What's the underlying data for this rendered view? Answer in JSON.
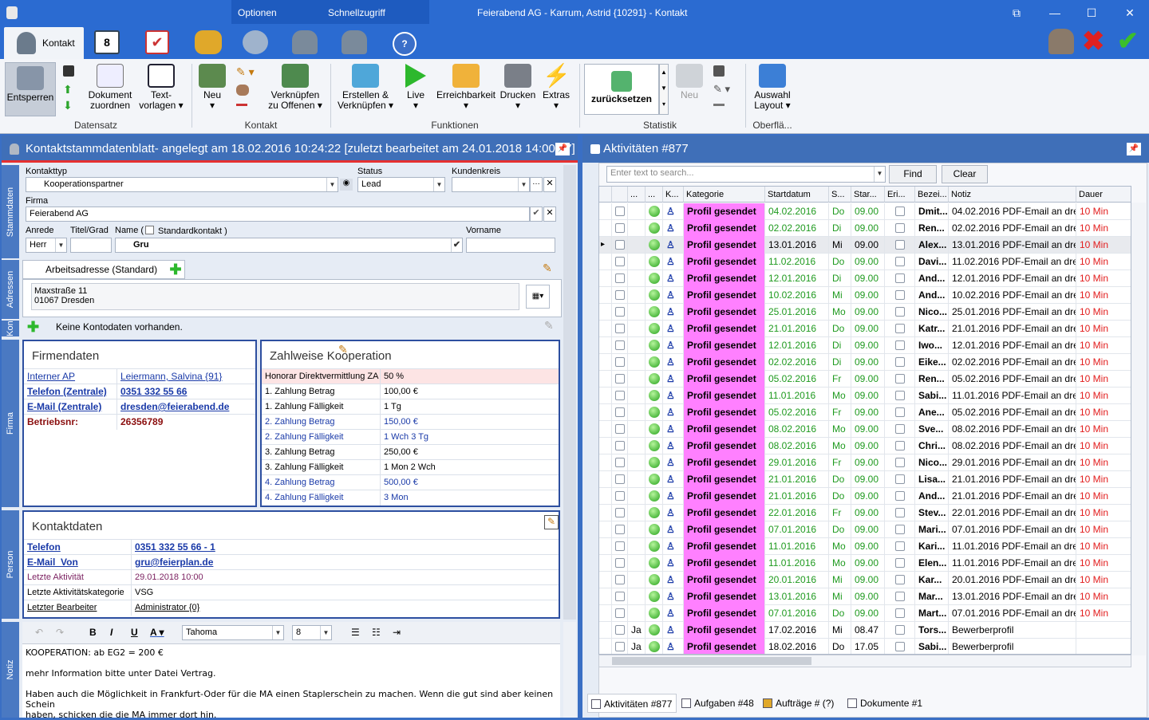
{
  "window": {
    "title": "Feierabend AG - Karrum, Astrid {10291} - Kontakt",
    "ctx_tab1": "Optionen",
    "ctx_tab2": "Schnellzugriff"
  },
  "ribbon": {
    "active_tab": "Kontakt",
    "buttons": {
      "entsperren": "Entsperren",
      "dokument": "Dokument",
      "zuordnen": "zuordnen",
      "text": "Text-",
      "vorlagen": "vorlagen ▾",
      "neu": "Neu",
      "verknuepfen": "Verknüpfen",
      "zu_offenen": "zu Offenen ▾",
      "erstellen": "Erstellen &",
      "verknuepfen2": "Verknüpfen ▾",
      "live": "Live",
      "erreichbarkeit": "Erreichbarkeit",
      "drucken": "Drucken",
      "extras": "Extras",
      "zuruecksetzen": "zurücksetzen",
      "neu2": "Neu",
      "auswahl": "Auswahl",
      "layout": "Layout ▾"
    },
    "groups": [
      "Datensatz",
      "Kontakt",
      "Funktionen",
      "Statistik",
      "Oberflä..."
    ]
  },
  "left": {
    "header": "Kontaktstammdatenblatt- angelegt am 18.02.2016 10:24:22 [zuletzt bearbeitet am 24.01.2018 14:00:37]",
    "vtabs": [
      "Stammdaten",
      "Adressen",
      "Kon",
      "Firma",
      "Person",
      "Notiz"
    ],
    "labels": {
      "kontakttyp": "Kontakttyp",
      "status": "Status",
      "kundenkreis": "Kundenkreis",
      "firma": "Firma",
      "anrede": "Anrede",
      "titel": "Titel/Grad",
      "name": "Name (",
      "standard": "Standardkontakt )",
      "vorname": "Vorname"
    },
    "values": {
      "kontakttyp": "Kooperationspartner",
      "status": "Lead",
      "kundenkreis": "",
      "firma": "Feierabend AG",
      "anrede": "Herr",
      "titel": "",
      "name": "Gru",
      "vorname": ""
    },
    "address_tab": "Arbeitsadresse (Standard)",
    "address": {
      "street": "Maxstraße 11",
      "city": "01067 Dresden"
    },
    "konto": "Keine Kontodaten vorhanden.",
    "firmendaten": {
      "title": "Firmendaten",
      "rows": [
        [
          "Interner AP",
          "Leiermann, Salvina {91}"
        ],
        [
          "Telefon (Zentrale)",
          "0351 332 55 66"
        ],
        [
          "E-Mail (Zentrale)",
          "dresden@feierabend.de"
        ],
        [
          "Betriebsnr:",
          "26356789"
        ]
      ]
    },
    "zahlweise": {
      "title": "Zahlweise Kooperation",
      "rows": [
        [
          "Honorar Direktvermittlung ZA",
          "50 %"
        ],
        [
          "1. Zahlung Betrag",
          "100,00 €"
        ],
        [
          "1. Zahlung Fälligkeit",
          "1 Tg"
        ],
        [
          "2. Zahlung Betrag",
          "150,00 €"
        ],
        [
          "2. Zahlung Fälligkeit",
          "1 Wch 3 Tg"
        ],
        [
          "3. Zahlung Betrag",
          "250,00 €"
        ],
        [
          "3. Zahlung Fälligkeit",
          "1 Mon 2 Wch"
        ],
        [
          "4. Zahlung Betrag",
          "500,00 €"
        ],
        [
          "4. Zahlung Fälligkeit",
          "3 Mon"
        ]
      ]
    },
    "kontaktdaten": {
      "title": "Kontaktdaten",
      "rows": [
        [
          "Telefon",
          "0351 332 55 66 - 1"
        ],
        [
          "E-Mail_Von",
          "gru@feierplan.de"
        ],
        [
          "Letzte Aktivität",
          "29.01.2018 10:00"
        ],
        [
          "Letzte Aktivitätskategorie",
          "VSG"
        ],
        [
          "Letzter Bearbeiter",
          "Administrator {0}"
        ]
      ]
    },
    "editor": {
      "font": "Tahoma",
      "size": "8",
      "lines": [
        "KOOPERATION: ab EG2 = 200 €",
        "mehr Information bitte unter Datei Vertrag.",
        "Haben auch die Möglichkeit in Frankfurt-Oder für die MA einen Staplerschein zu machen. Wenn die gut sind aber keinen Schein",
        "haben, schicken die die MA immer dort hin."
      ]
    }
  },
  "right": {
    "header": "Aktivitäten #877",
    "search_placeholder": "Enter text to search...",
    "find": "Find",
    "clear": "Clear",
    "columns": [
      "...",
      "...",
      "K...",
      "Kategorie",
      "Startdatum",
      "S...",
      "Star...",
      "Eri...",
      "Bezei...",
      "Notiz",
      "Dauer"
    ],
    "rows": [
      [
        "",
        "Profil gesendet",
        "04.02.2016",
        "Do",
        "09.00",
        "Dmit...",
        "04.02.2016 PDF-Email an dre...",
        "10 Min",
        "g"
      ],
      [
        "",
        "Profil gesendet",
        "02.02.2016",
        "Di",
        "09.00",
        "Ren...",
        "02.02.2016 PDF-Email an dre...",
        "10 Min",
        "g"
      ],
      [
        "",
        "Profil gesendet",
        "13.01.2016",
        "Mi",
        "09.00",
        "Alex...",
        "13.01.2016 PDF-Email an dre...",
        "10 Min",
        "s"
      ],
      [
        "",
        "Profil gesendet",
        "11.02.2016",
        "Do",
        "09.00",
        "Davi...",
        "11.02.2016 PDF-Email an dre...",
        "10 Min",
        "g"
      ],
      [
        "",
        "Profil gesendet",
        "12.01.2016",
        "Di",
        "09.00",
        "And...",
        "12.01.2016 PDF-Email an dre...",
        "10 Min",
        "g"
      ],
      [
        "",
        "Profil gesendet",
        "10.02.2016",
        "Mi",
        "09.00",
        "And...",
        "10.02.2016 PDF-Email an dre...",
        "10 Min",
        "g"
      ],
      [
        "",
        "Profil gesendet",
        "25.01.2016",
        "Mo",
        "09.00",
        "Nico...",
        "25.01.2016 PDF-Email an dre...",
        "10 Min",
        "g"
      ],
      [
        "",
        "Profil gesendet",
        "21.01.2016",
        "Do",
        "09.00",
        "Katr...",
        "21.01.2016 PDF-Email an dre...",
        "10 Min",
        "g"
      ],
      [
        "",
        "Profil gesendet",
        "12.01.2016",
        "Di",
        "09.00",
        "Iwo...",
        "12.01.2016 PDF-Email an dre...",
        "10 Min",
        "g"
      ],
      [
        "",
        "Profil gesendet",
        "02.02.2016",
        "Di",
        "09.00",
        "Eike...",
        "02.02.2016 PDF-Email an dre...",
        "10 Min",
        "g"
      ],
      [
        "",
        "Profil gesendet",
        "05.02.2016",
        "Fr",
        "09.00",
        "Ren...",
        "05.02.2016 PDF-Email an dre...",
        "10 Min",
        "g"
      ],
      [
        "",
        "Profil gesendet",
        "11.01.2016",
        "Mo",
        "09.00",
        "Sabi...",
        "11.01.2016 PDF-Email an dre...",
        "10 Min",
        "g"
      ],
      [
        "",
        "Profil gesendet",
        "05.02.2016",
        "Fr",
        "09.00",
        "Ane...",
        "05.02.2016 PDF-Email an dre...",
        "10 Min",
        "g"
      ],
      [
        "",
        "Profil gesendet",
        "08.02.2016",
        "Mo",
        "09.00",
        "Sve...",
        "08.02.2016 PDF-Email an dre...",
        "10 Min",
        "g"
      ],
      [
        "",
        "Profil gesendet",
        "08.02.2016",
        "Mo",
        "09.00",
        "Chri...",
        "08.02.2016 PDF-Email an dre...",
        "10 Min",
        "g"
      ],
      [
        "",
        "Profil gesendet",
        "29.01.2016",
        "Fr",
        "09.00",
        "Nico...",
        "29.01.2016 PDF-Email an dre...",
        "10 Min",
        "g"
      ],
      [
        "",
        "Profil gesendet",
        "21.01.2016",
        "Do",
        "09.00",
        "Lisa...",
        "21.01.2016 PDF-Email an dre...",
        "10 Min",
        "g"
      ],
      [
        "",
        "Profil gesendet",
        "21.01.2016",
        "Do",
        "09.00",
        "And...",
        "21.01.2016 PDF-Email an dre...",
        "10 Min",
        "g"
      ],
      [
        "",
        "Profil gesendet",
        "22.01.2016",
        "Fr",
        "09.00",
        "Stev...",
        "22.01.2016 PDF-Email an dre...",
        "10 Min",
        "g"
      ],
      [
        "",
        "Profil gesendet",
        "07.01.2016",
        "Do",
        "09.00",
        "Mari...",
        "07.01.2016 PDF-Email an dre...",
        "10 Min",
        "g"
      ],
      [
        "",
        "Profil gesendet",
        "11.01.2016",
        "Mo",
        "09.00",
        "Kari...",
        "11.01.2016 PDF-Email an dre...",
        "10 Min",
        "g"
      ],
      [
        "",
        "Profil gesendet",
        "11.01.2016",
        "Mo",
        "09.00",
        "Elen...",
        "11.01.2016 PDF-Email an dre...",
        "10 Min",
        "g"
      ],
      [
        "",
        "Profil gesendet",
        "20.01.2016",
        "Mi",
        "09.00",
        "Kar...",
        "20.01.2016 PDF-Email an dre...",
        "10 Min",
        "g"
      ],
      [
        "",
        "Profil gesendet",
        "13.01.2016",
        "Mi",
        "09.00",
        "Mar...",
        "13.01.2016 PDF-Email an dre...",
        "10 Min",
        "g"
      ],
      [
        "",
        "Profil gesendet",
        "07.01.2016",
        "Do",
        "09.00",
        "Mart...",
        "07.01.2016 PDF-Email an dre...",
        "10 Min",
        "g"
      ],
      [
        "Ja",
        "Profil gesendet",
        "17.02.2016",
        "Mi",
        "08.47",
        "Tors...",
        "Bewerberprofil",
        "",
        "b"
      ],
      [
        "Ja",
        "Profil gesendet",
        "18.02.2016",
        "Do",
        "17.05",
        "Sabi...",
        "Bewerberprofil",
        "",
        "b"
      ]
    ],
    "bottom_tabs": [
      "Aktivitäten #877",
      "Aufgaben #48",
      "Aufträge # (?)",
      "Dokumente #1"
    ]
  },
  "colors": {
    "accent": "#2b6bd1",
    "category": "#ff80ff",
    "date_green": "#1f9a1f",
    "duration_red": "#e21d1d",
    "header_red": "#e53030"
  }
}
